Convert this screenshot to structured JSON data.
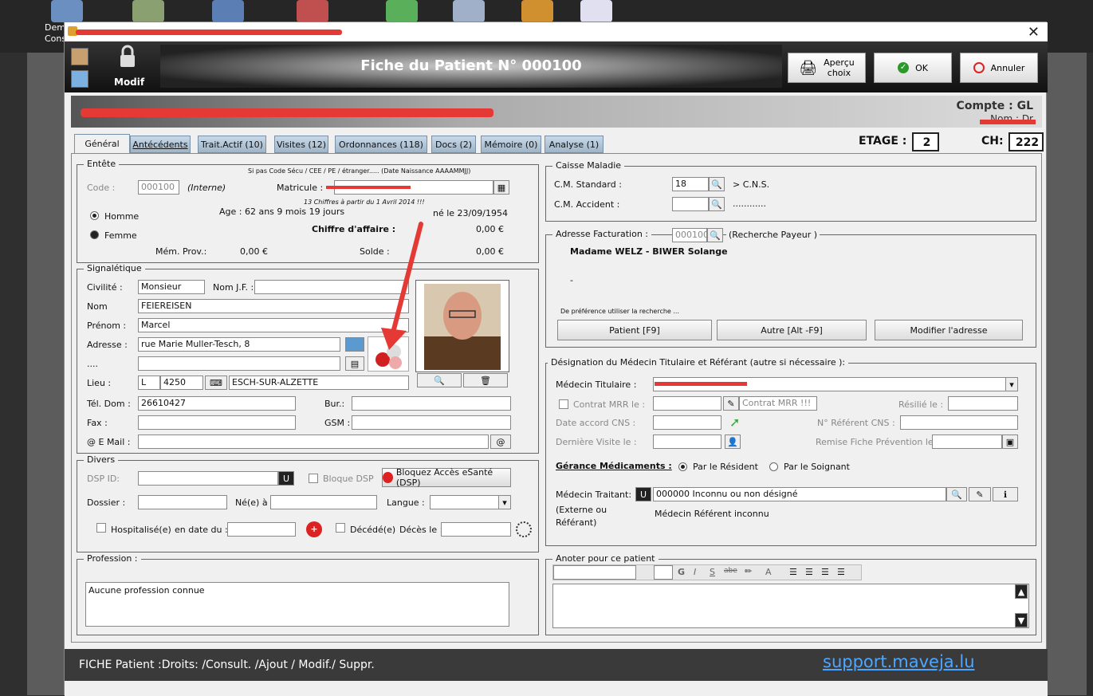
{
  "background": {
    "left_labels": [
      "Dem",
      "Consu"
    ],
    "icons": [
      "documents-icon",
      "users-icon",
      "patients-icon",
      "medical-icon",
      "checklist-icon",
      "file-icon",
      "euro-icon",
      "visa-icon"
    ]
  },
  "window": {
    "close_label": "✕"
  },
  "toolbar": {
    "modif_label": "Modif",
    "title": "Fiche du Patient N° 000100",
    "apercu_label": "Aperçu\nchoix",
    "ok_label": "OK",
    "annuler_label": "Annuler"
  },
  "header": {
    "compte": "Compte :  GL",
    "nom": "Nom : Dr"
  },
  "tabs": [
    "Général",
    "Antécédents",
    "Trait.Actif (10)",
    "Visites (12)",
    "Ordonnances (118)",
    "Docs (2)",
    "Mémoire (0)",
    "Analyse (1)"
  ],
  "etage": {
    "label": "ETAGE :",
    "value": "2"
  },
  "ch": {
    "label": "CH:",
    "value": "222"
  },
  "entete": {
    "legend": "Entête",
    "hint": "Si pas Code Sécu / CEE / PE / étranger..... (Date Naissance   AAAAMMJJ)",
    "code_label": "Code :",
    "code_value": "000100",
    "interne": "(Interne)",
    "matricule_label": "Matricule :",
    "hint2": "13 Chiffres à partir du 1 Avril 2014 !!!",
    "homme": "Homme",
    "femme": "Femme",
    "age": "Age : 62 ans 9 mois 19 jours",
    "ne": "né le 23/09/1954",
    "ca_label": "Chiffre d'affaire :",
    "ca_value": "0,00 €",
    "mem_label": "Mém. Prov.:",
    "mem_value": "0,00 €",
    "solde_label": "Solde :",
    "solde_value": "0,00 €"
  },
  "signaletique": {
    "legend": "Signalétique",
    "civilite_label": "Civilité :",
    "civilite": "Monsieur",
    "nomjf_label": "Nom J.F. :",
    "nom_label": "Nom",
    "nom": "FEIEREISEN",
    "prenom_label": "Prénom :",
    "prenom": "Marcel",
    "adresse_label": "Adresse :",
    "adresse": "rue Marie Muller-Tesch, 8",
    "dots": "....",
    "lieu_label": "Lieu :",
    "pays": "L",
    "cp": "4250",
    "ville": "ESCH-SUR-ALZETTE",
    "teldom_label": "Tél. Dom :",
    "teldom": "26610427",
    "bur_label": "Bur.:",
    "fax_label": "Fax :",
    "gsm_label": "GSM :",
    "email_label": "@ E Mail :"
  },
  "divers": {
    "legend": "Divers",
    "dsp_label": "DSP ID:",
    "bloque_dsp": "Bloque DSP",
    "bloquez_btn": "Bloquez Accès eSanté (DSP)",
    "dossier_label": "Dossier :",
    "ne_a_label": "Né(e) à :",
    "langue_label": "Langue :",
    "hospitalise": "Hospitalisé(e)",
    "en_date_du": "en date du :",
    "decede": "Décédé(e)",
    "deces_le": "Décès le :"
  },
  "profession": {
    "legend": "Profession :",
    "value": "Aucune profession connue"
  },
  "caisse": {
    "legend": "Caisse Maladie",
    "std_label": "C.M. Standard :",
    "std_value": "18",
    "cns": "> C.N.S.",
    "acc_label": "C.M. Accident :",
    "acc_dots": "............"
  },
  "facturation": {
    "legend": "Adresse Facturation :",
    "code": "000100",
    "recherche": "(Recherche Payeur  )",
    "name": "Madame WELZ - BIWER Solange",
    "dash": "-",
    "pref": "De préférence utiliser la recherche ...",
    "btn_patient": "Patient [F9]",
    "btn_autre": "Autre [Alt -F9]",
    "btn_modifier": "Modifier l'adresse"
  },
  "medecin": {
    "legend": "Désignation du Médecin Titulaire et Référant (autre si nécessaire ):",
    "titulaire_label": "Médecin Titulaire :",
    "contrat_mrr_label": "Contrat MRR le :",
    "contrat_mrr_select": "Contrat MRR !!!",
    "resilie_label": "Résilié le :",
    "date_accord_label": "Date accord CNS :",
    "ref_cns_label": "N° Référent CNS :",
    "derniere_visite_label": "Dernière Visite le :",
    "remise_label": "Remise Fiche Prévention le :",
    "gerance_label": "Gérance Médicaments :",
    "par_resident": "Par le Résident",
    "par_soignant": "Par le Soignant",
    "traitant_label": "Médecin Traitant:",
    "externe": "(Externe ou\nRéférant)",
    "traitant_value": "000000 Inconnu ou non désigné",
    "referent_inconnu": "Médecin Référent inconnu"
  },
  "anoter": {
    "legend": "Anoter pour ce patient"
  },
  "footer": {
    "left": "FICHE Patient :Droits: /Consult. /Ajout / Modif./ Suppr.",
    "link": "support.maveja.lu"
  }
}
